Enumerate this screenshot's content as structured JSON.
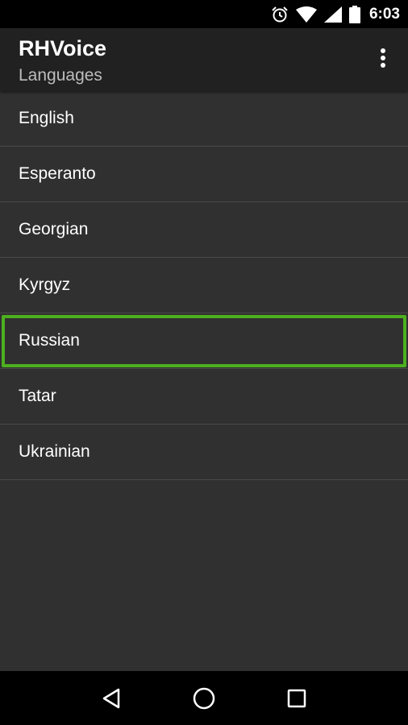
{
  "status_bar": {
    "time": "6:03",
    "icons": [
      "alarm-icon",
      "wifi-icon",
      "signal-icon",
      "battery-icon"
    ]
  },
  "app_bar": {
    "title": "RHVoice",
    "subtitle": "Languages",
    "menu_icon": "overflow-menu-icon"
  },
  "languages": [
    {
      "label": "English"
    },
    {
      "label": "Esperanto"
    },
    {
      "label": "Georgian"
    },
    {
      "label": "Kyrgyz"
    },
    {
      "label": "Russian"
    },
    {
      "label": "Tatar"
    },
    {
      "label": "Ukrainian"
    }
  ],
  "selected_language": "Russian",
  "nav_bar": {
    "icons": [
      "back-icon",
      "home-icon",
      "recents-icon"
    ]
  },
  "colors": {
    "background": "#303030",
    "app_bar": "#212121",
    "status_bar": "#000000",
    "selection_outline": "#4caf1f",
    "divider": "#4a4a4a"
  }
}
